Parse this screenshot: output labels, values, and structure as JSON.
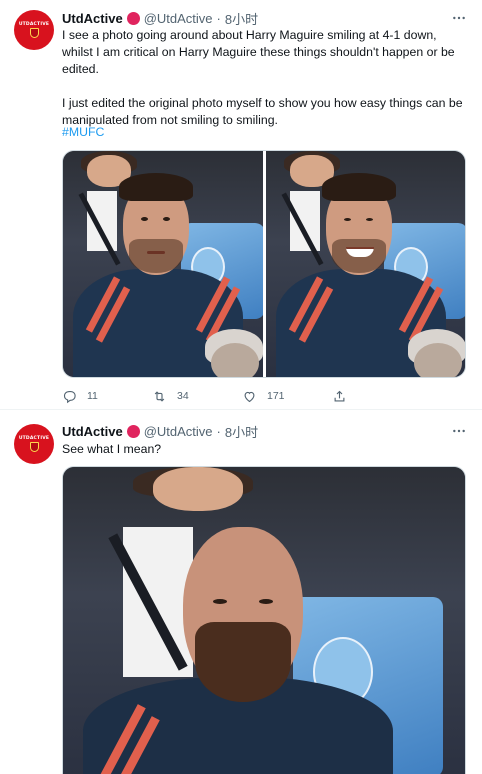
{
  "tweets": [
    {
      "display_name": "UtdActive",
      "handle": "@UtdActive",
      "separator": "·",
      "time": "8小时",
      "avatar_text": "UTDACTIVE",
      "text": "I see a photo going around about Harry Maguire smiling at 4-1 down, whilst I am critical on Harry Maguire these things shouldn't happen or be edited.\n\nI just edited the original photo myself to show you how easy things can be manipulated from not smiling to smiling.",
      "hashtag": "#MUFC",
      "actions": {
        "reply_count": "11",
        "retweet_count": "34",
        "like_count": "171"
      }
    },
    {
      "display_name": "UtdActive",
      "handle": "@UtdActive",
      "separator": "·",
      "time": "8小时",
      "avatar_text": "UTDACTIVE",
      "text": "See what I mean?"
    }
  ],
  "colors": {
    "accent": "#1d9bf0",
    "badge": "#e0245e",
    "avatar_bg": "#d8121e",
    "muted": "#536471"
  },
  "icons": [
    "reply-icon",
    "retweet-icon",
    "like-icon",
    "share-icon",
    "more-icon"
  ]
}
